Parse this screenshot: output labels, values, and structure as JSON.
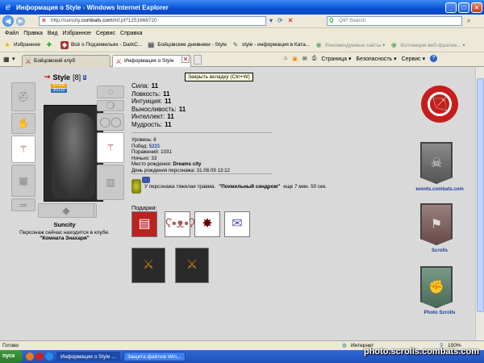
{
  "window": {
    "title": "Информация о Style - Windows Internet Explorer",
    "min": "_",
    "max": "□",
    "close": "×"
  },
  "address": {
    "prefix": "http://suncity.",
    "domain": "combats.com",
    "suffix": "/inf.pl?1251666720",
    "search_placeholder": "QIP Search"
  },
  "menu": [
    "Файл",
    "Правка",
    "Вид",
    "Избранное",
    "Сервис",
    "Справка"
  ],
  "favorites": {
    "label": "Избранное",
    "items": [
      "Всё о Подземельях - DarkC...",
      "Бойцовские дневники - Style",
      "style - информация в Ката...",
      "Рекомендуемые сайты ▾",
      "Коллекция веб-фрагме... ▾"
    ]
  },
  "tabs": [
    {
      "label": "Бойцовский клуб"
    },
    {
      "label": "Информация о Style"
    }
  ],
  "commands": {
    "page": "Страница ▾",
    "security": "Безопасность ▾",
    "service": "Сервис ▾",
    "help": "?"
  },
  "tooltip": "Закрыть вкладку (Ctrl+W)",
  "character": {
    "name": "Style",
    "level": "[8]",
    "badge": "i",
    "hp": "97/186",
    "mp": "36/110",
    "city": "Suncity",
    "location_text": "Персонаж сейчас находится в клубе.",
    "location": "\"Комната Знахаря\""
  },
  "stats": [
    {
      "label": "Сила:",
      "value": "11"
    },
    {
      "label": "Ловкость:",
      "value": "11"
    },
    {
      "label": "Интуиция:",
      "value": "11"
    },
    {
      "label": "Выносливость:",
      "value": "11"
    },
    {
      "label": "Интеллект:",
      "value": "11"
    },
    {
      "label": "Мудрость:",
      "value": "11"
    }
  ],
  "info": {
    "level_label": "Уровень:",
    "level_value": "8",
    "wins_label": "Побед:",
    "wins_value": "5221",
    "losses_label": "Поражений:",
    "losses_value": "1031",
    "draws_label": "Ничьих:",
    "draws_value": "33",
    "birthplace_label": "Место рождения:",
    "birthplace_value": "Dreams city",
    "birthday_label": "День рождения персонажа:",
    "birthday_value": "31.08.09 13:12"
  },
  "trauma": {
    "text": "У персонажа тяжелая травма.",
    "name": "\"Похмельный синдром\"",
    "remaining": "еще 7 мин. 50 сек."
  },
  "gifts_label": "Подарки:",
  "sidebar_links": {
    "events": "events.combats.com",
    "scrolls": "Scrolls",
    "photo": "Photo Scrolls"
  },
  "status": {
    "left": "Готово",
    "zone": "Интернет",
    "zoom": "100%"
  },
  "taskbar": {
    "start": "пуск",
    "items": [
      "Информация о Style ...",
      "Защита файлов Win..."
    ]
  },
  "watermark": "photo.scrolls.combats.com"
}
